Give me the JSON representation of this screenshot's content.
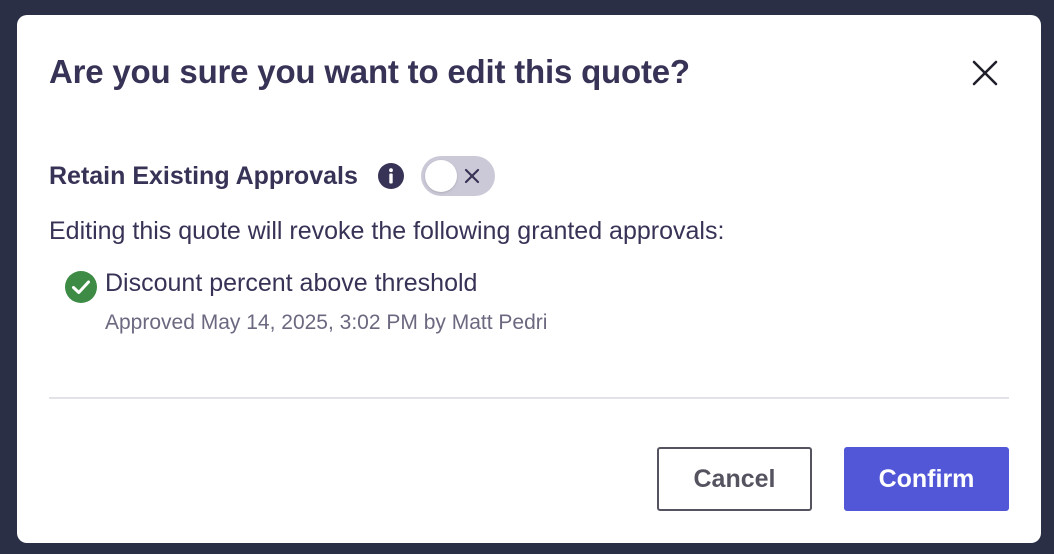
{
  "dialog": {
    "title": "Are you sure you want to edit this quote?",
    "close_icon": "close-icon"
  },
  "retain": {
    "label": "Retain Existing Approvals",
    "info_icon": "info-icon",
    "toggle_state": "off"
  },
  "description": "Editing this quote will revoke the following granted approvals:",
  "approvals": [
    {
      "name": "Discount percent above threshold",
      "meta": "Approved May 14, 2025, 3:02 PM by Matt Pedri",
      "icon": "check-circle-icon"
    }
  ],
  "buttons": {
    "cancel_label": "Cancel",
    "confirm_label": "Confirm"
  },
  "colors": {
    "backdrop": "#2b2f45",
    "text_primary": "#373356",
    "text_secondary": "#6b6880",
    "confirm_bg": "#5157d7",
    "success_green": "#3d8b45",
    "toggle_off": "#cbc9d7"
  }
}
